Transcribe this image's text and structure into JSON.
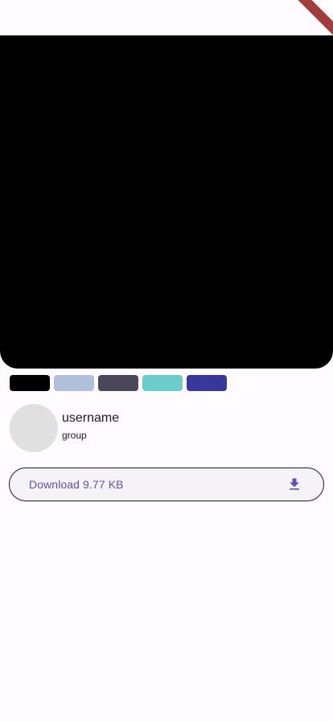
{
  "palette": {
    "colors": [
      "#000000",
      "#b0c0dc",
      "#484658",
      "#6ccccc",
      "#38389c"
    ]
  },
  "user": {
    "name": "username",
    "group": "group"
  },
  "download": {
    "label": "Download 9.77 KB",
    "icon": "download-icon"
  },
  "theme": {
    "accent": "#6750a4",
    "background": "#fffbfe",
    "image_background": "#000000",
    "avatar_placeholder": "#e0e0e0"
  }
}
